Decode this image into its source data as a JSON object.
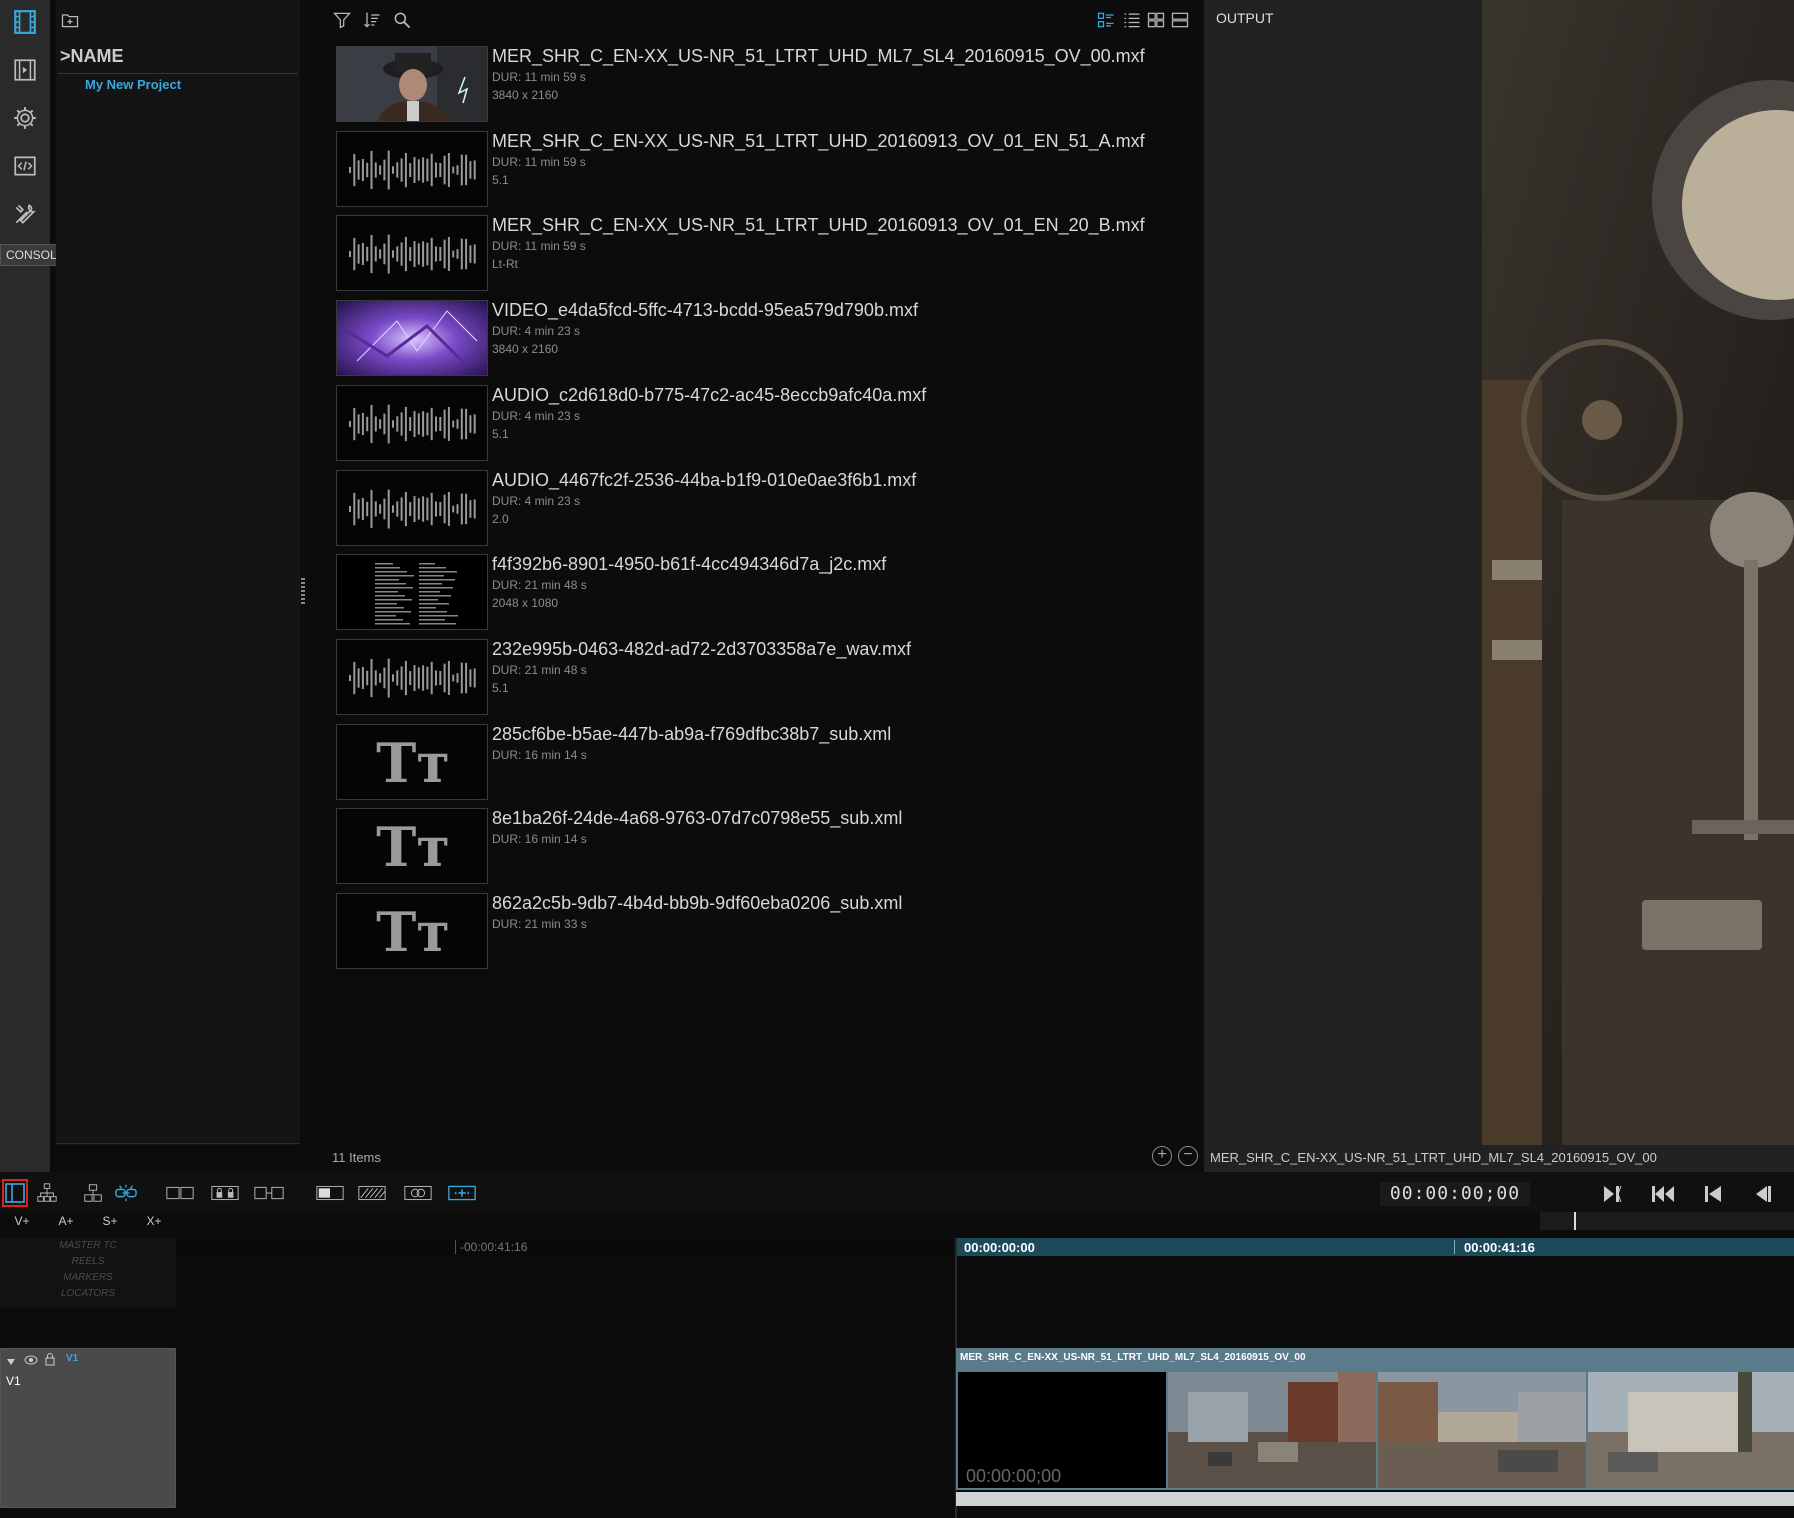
{
  "rail": {
    "tooltip": "CONSOLE"
  },
  "project": {
    "header": ">NAME",
    "items": [
      "My New Project"
    ]
  },
  "media": {
    "count_label": "11 Items",
    "items": [
      {
        "name": "MER_SHR_C_EN-XX_US-NR_51_LTRT_UHD_ML7_SL4_20160915_OV_00.mxf",
        "dur": "DUR: 11 min 59 s",
        "res": "3840 x 2160",
        "kind": "video-person"
      },
      {
        "name": "MER_SHR_C_EN-XX_US-NR_51_LTRT_UHD_20160913_OV_01_EN_51_A.mxf",
        "dur": "DUR: 11 min 59 s",
        "res": "5.1",
        "kind": "audio"
      },
      {
        "name": "MER_SHR_C_EN-XX_US-NR_51_LTRT_UHD_20160913_OV_01_EN_20_B.mxf",
        "dur": "DUR: 11 min 59 s",
        "res": "Lt-Rt",
        "kind": "audio"
      },
      {
        "name": "VIDEO_e4da5fcd-5ffc-4713-bcdd-95ea579d790b.mxf",
        "dur": "DUR: 4 min 23 s",
        "res": "3840 x 2160",
        "kind": "video-purple"
      },
      {
        "name": "AUDIO_c2d618d0-b775-47c2-ac45-8eccb9afc40a.mxf",
        "dur": "DUR: 4 min 23 s",
        "res": "5.1",
        "kind": "audio"
      },
      {
        "name": "AUDIO_4467fc2f-2536-44ba-b1f9-010e0ae3f6b1.mxf",
        "dur": "DUR: 4 min 23 s",
        "res": "2.0",
        "kind": "audio"
      },
      {
        "name": "f4f392b6-8901-4950-b61f-4cc494346d7a_j2c.mxf",
        "dur": "DUR: 21 min 48 s",
        "res": "2048 x 1080",
        "kind": "video-credits"
      },
      {
        "name": "232e995b-0463-482d-ad72-2d3703358a7e_wav.mxf",
        "dur": "DUR: 21 min 48 s",
        "res": "5.1",
        "kind": "audio"
      },
      {
        "name": "285cf6be-b5ae-447b-ab9a-f769dfbc38b7_sub.xml",
        "dur": "DUR: 16 min 14 s",
        "res": "",
        "kind": "text"
      },
      {
        "name": "8e1ba26f-24de-4a68-9763-07d7c0798e55_sub.xml",
        "dur": "DUR: 16 min 14 s",
        "res": "",
        "kind": "text"
      },
      {
        "name": "862a2c5b-9db7-4b4d-bb9b-9df60eba0206_sub.xml",
        "dur": "DUR: 21 min 33 s",
        "res": "",
        "kind": "text"
      }
    ],
    "text_glyph": "Tт"
  },
  "output": {
    "label": "OUTPUT",
    "clip_name": "MER_SHR_C_EN-XX_US-NR_51_LTRT_UHD_ML7_SL4_20160915_OV_00"
  },
  "transport": {
    "timecode": "00:00:00;00"
  },
  "track_add": {
    "video": "V+",
    "audio": "A+",
    "sub": "S+",
    "extra": "X+"
  },
  "timeline": {
    "lanes": [
      "MASTER TC",
      "REELS",
      "MARKERS",
      "LOCATORS"
    ],
    "ruler_left_tc": "-00:00:41:16",
    "ruler_start_tc": "00:00:00:00",
    "ruler_next_tc": "00:00:41:16",
    "track": {
      "id": "V1",
      "label": "V1"
    },
    "clip": {
      "name": "MER_SHR_C_EN-XX_US-NR_51_LTRT_UHD_ML7_SL4_20160915_OV_00",
      "timecode": "00:00:00;00"
    }
  },
  "colors": {
    "accent": "#3aa8dd",
    "highlight": "#e02020",
    "clip": "#5a7b89"
  }
}
